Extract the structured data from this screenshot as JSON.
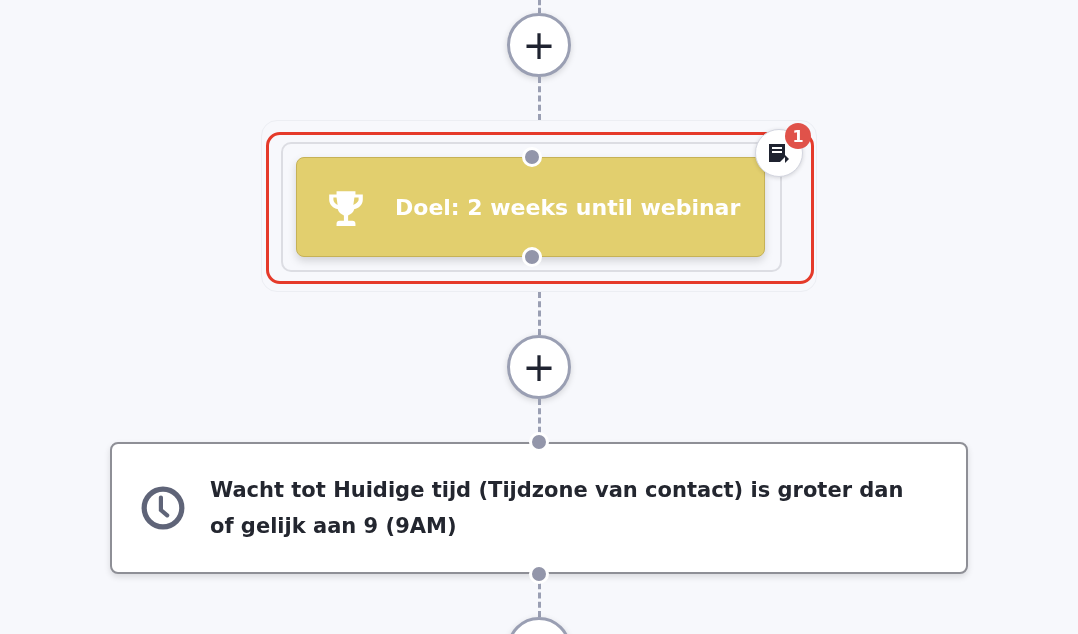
{
  "flow": [
    {
      "kind": "add",
      "label": "+"
    },
    {
      "kind": "goal",
      "text": "Doel: 2 weeks until webinar",
      "selected": true,
      "badge": "1"
    },
    {
      "kind": "add",
      "label": "+"
    },
    {
      "kind": "wait",
      "text": "Wacht tot Huidige tijd (Tijdzone van contact) is groter dan of gelijk aan 9 (9AM)"
    },
    {
      "kind": "add"
    }
  ]
}
